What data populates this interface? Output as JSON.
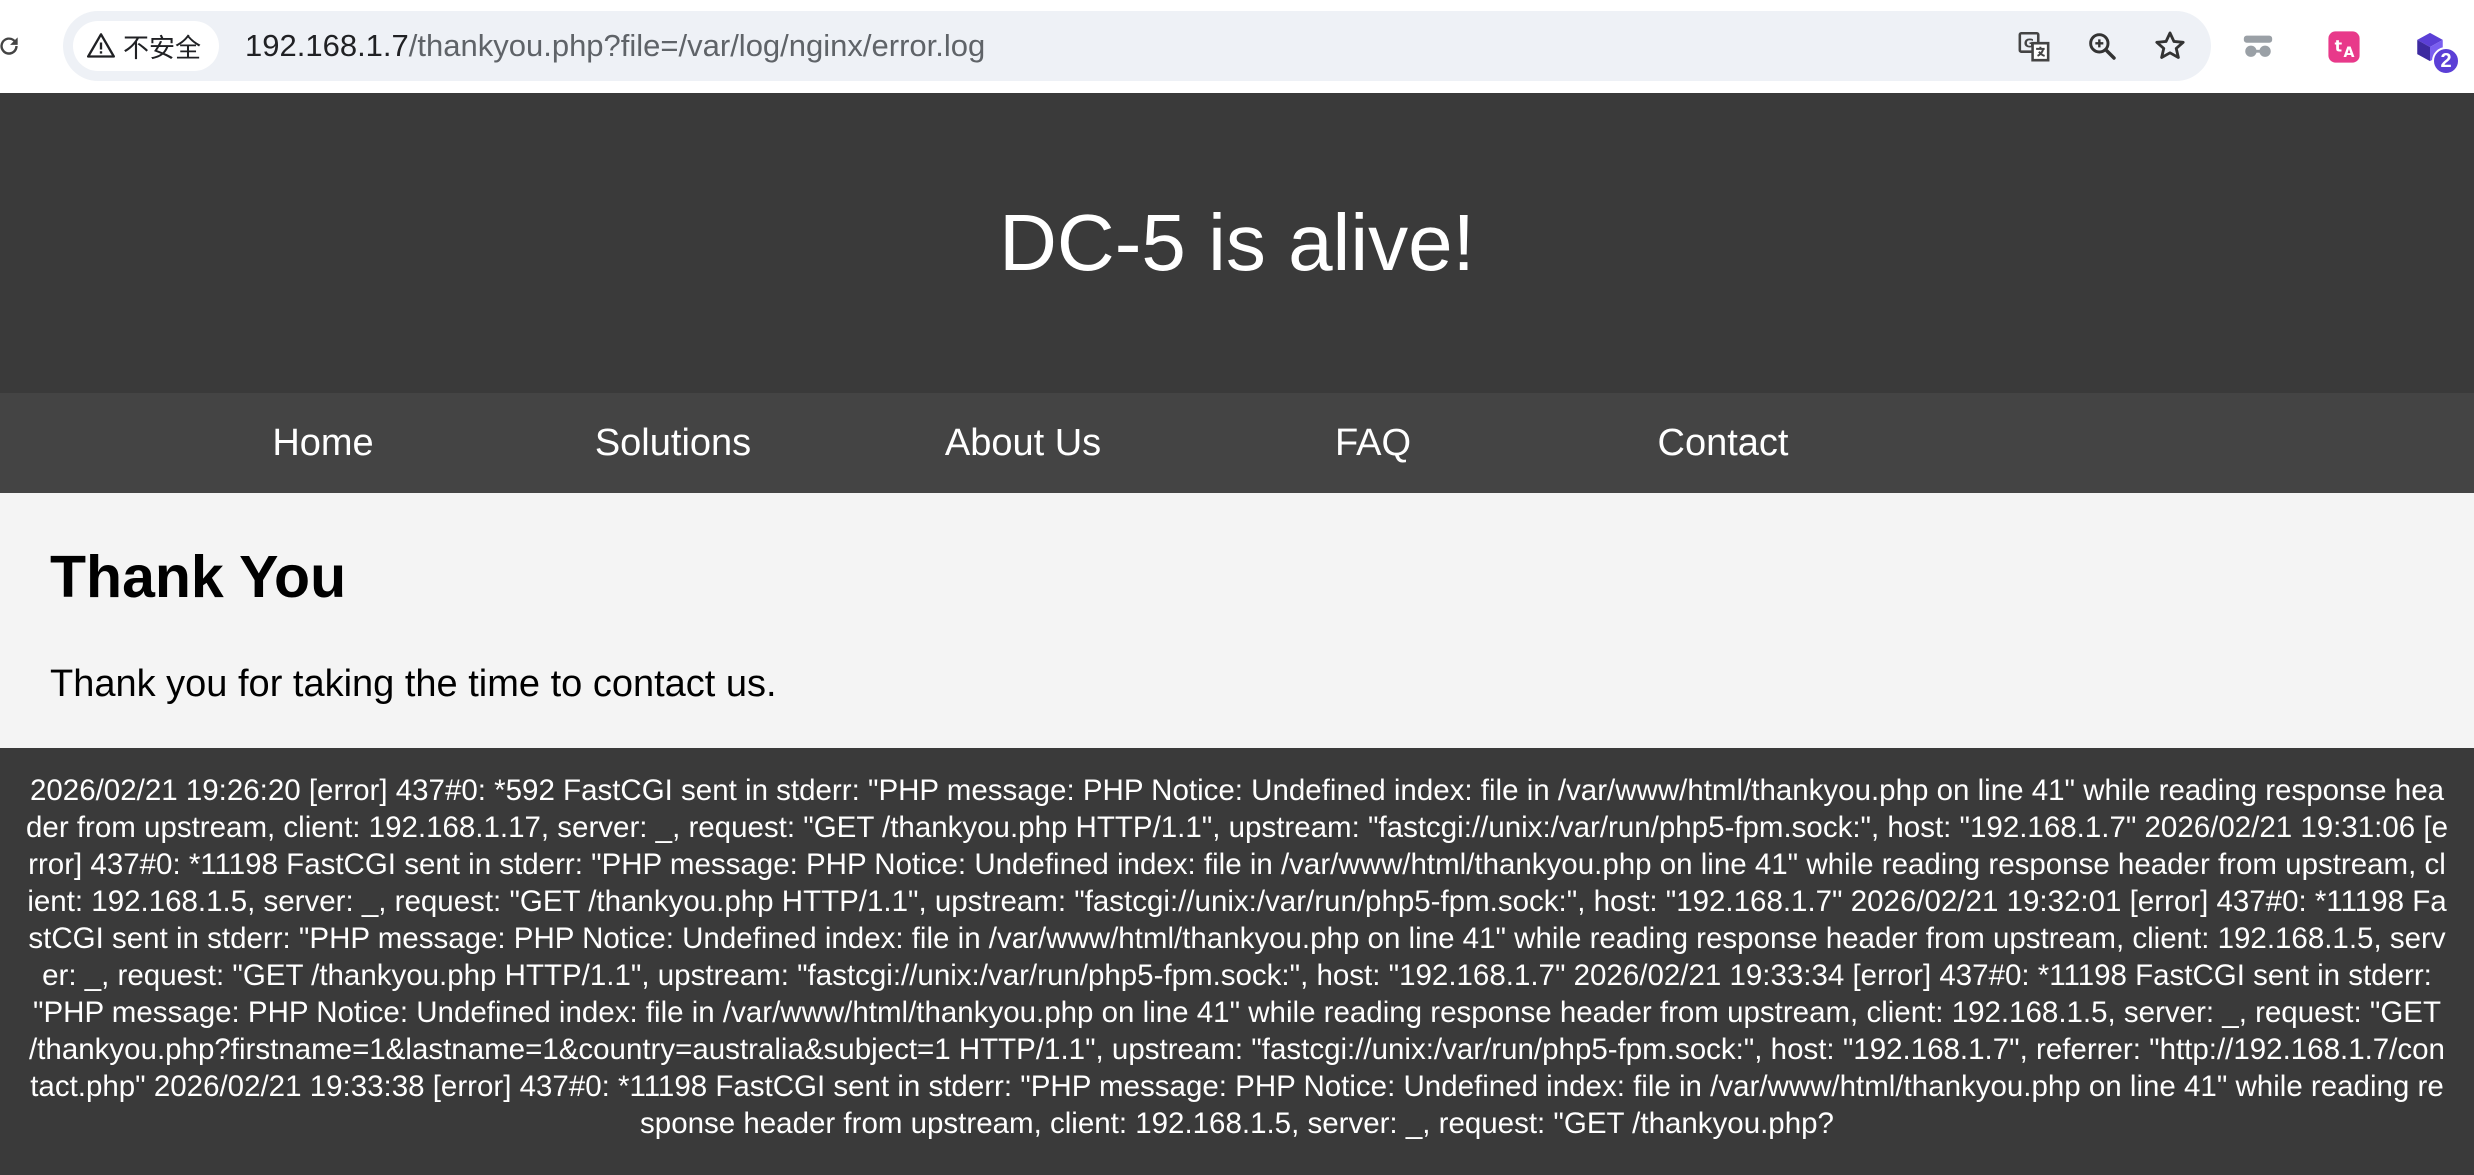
{
  "browser": {
    "security_label": "不安全",
    "url_host": "192.168.1.7",
    "url_path": "/thankyou.php?file=/var/log/nginx/error.log",
    "extension_badge": "2"
  },
  "header": {
    "title": "DC-5 is alive!"
  },
  "nav": {
    "items": [
      {
        "label": "Home"
      },
      {
        "label": "Solutions"
      },
      {
        "label": "About Us"
      },
      {
        "label": "FAQ"
      },
      {
        "label": "Contact"
      }
    ]
  },
  "content": {
    "heading": "Thank You",
    "message": "Thank you for taking the time to contact us."
  },
  "log": {
    "text": "2026/02/21 19:26:20 [error] 437#0: *592 FastCGI sent in stderr: \"PHP message: PHP Notice: Undefined index: file in /var/www/html/thankyou.php on line 41\" while reading response header from upstream, client: 192.168.1.17, server: _, request: \"GET /thankyou.php HTTP/1.1\", upstream: \"fastcgi://unix:/var/run/php5-fpm.sock:\", host: \"192.168.1.7\" 2026/02/21 19:31:06 [error] 437#0: *11198 FastCGI sent in stderr: \"PHP message: PHP Notice: Undefined index: file in /var/www/html/thankyou.php on line 41\" while reading response header from upstream, client: 192.168.1.5, server: _, request: \"GET /thankyou.php HTTP/1.1\", upstream: \"fastcgi://unix:/var/run/php5-fpm.sock:\", host: \"192.168.1.7\" 2026/02/21 19:32:01 [error] 437#0: *11198 FastCGI sent in stderr: \"PHP message: PHP Notice: Undefined index: file in /var/www/html/thankyou.php on line 41\" while reading response header from upstream, client: 192.168.1.5, server: _, request: \"GET /thankyou.php HTTP/1.1\", upstream: \"fastcgi://unix:/var/run/php5-fpm.sock:\", host: \"192.168.1.7\" 2026/02/21 19:33:34 [error] 437#0: *11198 FastCGI sent in stderr: \"PHP message: PHP Notice: Undefined index: file in /var/www/html/thankyou.php on line 41\" while reading response header from upstream, client: 192.168.1.5, server: _, request: \"GET /thankyou.php?firstname=1&lastname=1&country=australia&subject=1 HTTP/1.1\", upstream: \"fastcgi://unix:/var/run/php5-fpm.sock:\", host: \"192.168.1.7\", referrer: \"http://192.168.1.7/contact.php\" 2026/02/21 19:33:38 [error] 437#0: *11198 FastCGI sent in stderr: \"PHP message: PHP Notice: Undefined index: file in /var/www/html/thankyou.php on line 41\" while reading response header from upstream, client: 192.168.1.5, server: _, request: \"GET /thankyou.php?"
  }
}
